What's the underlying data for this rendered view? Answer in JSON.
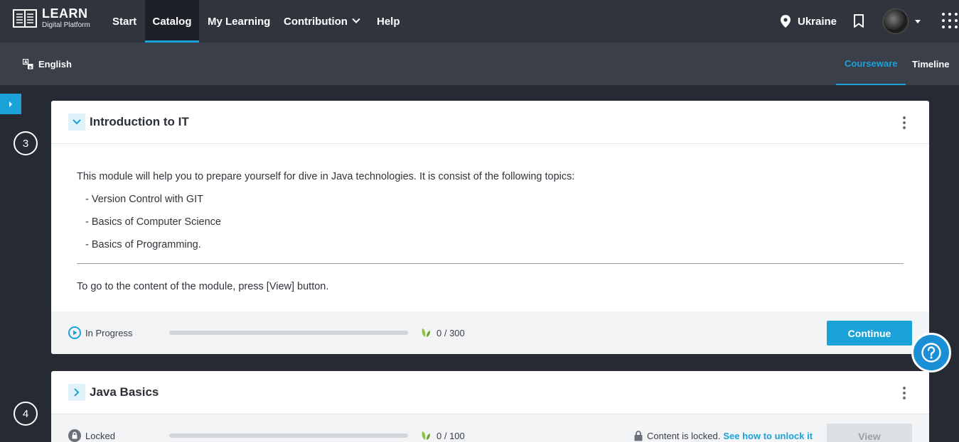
{
  "header": {
    "logo_title": "LEARN",
    "logo_subtitle": "Digital Platform",
    "nav": [
      {
        "label": "Start"
      },
      {
        "label": "Catalog"
      },
      {
        "label": "My Learning"
      },
      {
        "label": "Contribution"
      },
      {
        "label": "Help"
      }
    ],
    "active_nav": "Catalog",
    "location": "Ukraine"
  },
  "subbar": {
    "language": "English",
    "tabs": [
      {
        "label": "Courseware"
      },
      {
        "label": "Timeline"
      }
    ],
    "active_tab": "Courseware"
  },
  "modules": [
    {
      "number": "3",
      "title": "Introduction to IT",
      "expanded": true,
      "intro": "This module will help you to prepare yourself for dive in Java technologies. It is consist of the following topics:",
      "topics": [
        "- Version Control with GIT",
        "- Basics of Computer Science",
        "- Basics of Programming."
      ],
      "note": "To go to the content of the module, press [View] button.",
      "status": "In Progress",
      "progress": 0,
      "points": "0 / 300",
      "button": "Continue"
    },
    {
      "number": "4",
      "title": "Java Basics",
      "expanded": false,
      "status": "Locked",
      "progress": 0,
      "points": "0 / 100",
      "lock_text": "Content is locked.",
      "lock_link": "See how to unlock it",
      "button": "View"
    }
  ],
  "colors": {
    "accent": "#1ba2d9",
    "topbar": "#30343d",
    "subbar": "#3a3f4a",
    "background": "#252a33"
  }
}
